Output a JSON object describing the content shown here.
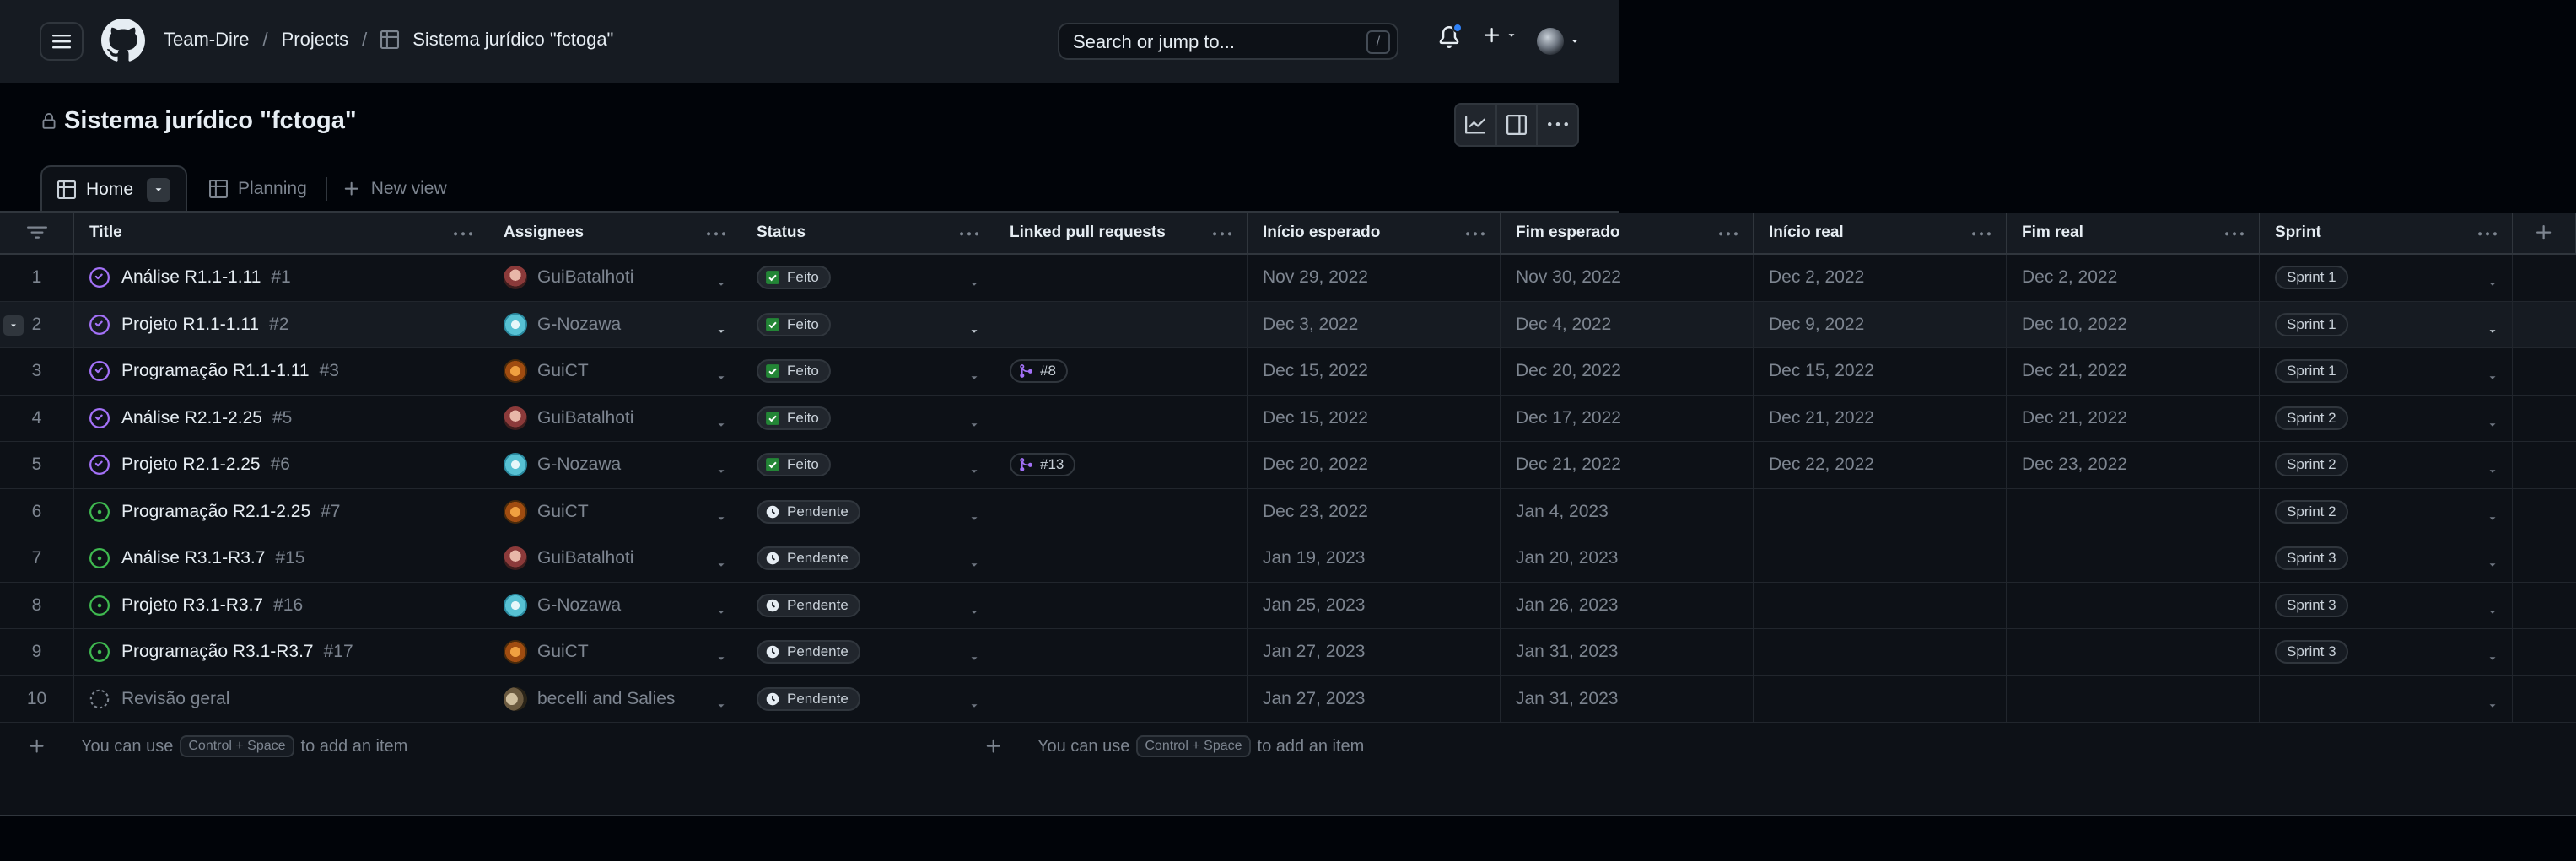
{
  "header": {
    "org": "Team-Dire",
    "projects": "Projects",
    "project": "Sistema jurídico \"fctoga\"",
    "search_placeholder": "Search or jump to...",
    "search_shortcut": "/"
  },
  "project_title": "Sistema jurídico \"fctoga\"",
  "views": {
    "home": "Home",
    "planning": "Planning",
    "new_view": "New view"
  },
  "columns": {
    "title": "Title",
    "assignees": "Assignees",
    "status": "Status",
    "linked_prs": "Linked pull requests",
    "inicio_esperado": "Início esperado",
    "fim_esperado": "Fim esperado",
    "inicio_real": "Início real",
    "fim_real": "Fim real",
    "sprint": "Sprint"
  },
  "rows": [
    {
      "n": "1",
      "title": "Análise R1.1-1.11",
      "num": "#1",
      "assignee": "GuiBatalhoti",
      "status": "Feito",
      "pr": "",
      "ie": "Nov 29, 2022",
      "fe": "Nov 30, 2022",
      "ir": "Dec 2, 2022",
      "fr": "Dec 2, 2022",
      "sprint": "Sprint 1"
    },
    {
      "n": "2",
      "title": "Projeto R1.1-1.11",
      "num": "#2",
      "assignee": "G-Nozawa",
      "status": "Feito",
      "pr": "",
      "ie": "Dec 3, 2022",
      "fe": "Dec 4, 2022",
      "ir": "Dec 9, 2022",
      "fr": "Dec 10, 2022",
      "sprint": "Sprint 1"
    },
    {
      "n": "3",
      "title": "Programação R1.1-1.11",
      "num": "#3",
      "assignee": "GuiCT",
      "status": "Feito",
      "pr": "#8",
      "ie": "Dec 15, 2022",
      "fe": "Dec 20, 2022",
      "ir": "Dec 15, 2022",
      "fr": "Dec 21, 2022",
      "sprint": "Sprint 1"
    },
    {
      "n": "4",
      "title": "Análise R2.1-2.25",
      "num": "#5",
      "assignee": "GuiBatalhoti",
      "status": "Feito",
      "pr": "",
      "ie": "Dec 15, 2022",
      "fe": "Dec 17, 2022",
      "ir": "Dec 21, 2022",
      "fr": "Dec 21, 2022",
      "sprint": "Sprint 2"
    },
    {
      "n": "5",
      "title": "Projeto R2.1-2.25",
      "num": "#6",
      "assignee": "G-Nozawa",
      "status": "Feito",
      "pr": "#13",
      "ie": "Dec 20, 2022",
      "fe": "Dec 21, 2022",
      "ir": "Dec 22, 2022",
      "fr": "Dec 23, 2022",
      "sprint": "Sprint 2"
    },
    {
      "n": "6",
      "title": "Programação R2.1-2.25",
      "num": "#7",
      "assignee": "GuiCT",
      "status": "Pendente",
      "pr": "",
      "ie": "Dec 23, 2022",
      "fe": "Jan 4, 2023",
      "ir": "",
      "fr": "",
      "sprint": "Sprint 2"
    },
    {
      "n": "7",
      "title": "Análise R3.1-R3.7",
      "num": "#15",
      "assignee": "GuiBatalhoti",
      "status": "Pendente",
      "pr": "",
      "ie": "Jan 19, 2023",
      "fe": "Jan 20, 2023",
      "ir": "",
      "fr": "",
      "sprint": "Sprint 3"
    },
    {
      "n": "8",
      "title": "Projeto R3.1-R3.7",
      "num": "#16",
      "assignee": "G-Nozawa",
      "status": "Pendente",
      "pr": "",
      "ie": "Jan 25, 2023",
      "fe": "Jan 26, 2023",
      "ir": "",
      "fr": "",
      "sprint": "Sprint 3"
    },
    {
      "n": "9",
      "title": "Programação R3.1-R3.7",
      "num": "#17",
      "assignee": "GuiCT",
      "status": "Pendente",
      "pr": "",
      "ie": "Jan 27, 2023",
      "fe": "Jan 31, 2023",
      "ir": "",
      "fr": "",
      "sprint": "Sprint 3"
    },
    {
      "n": "10",
      "title": "Revisão geral",
      "num": "",
      "assignee": "becelli and Salies",
      "status": "Pendente",
      "pr": "",
      "ie": "Jan 27, 2023",
      "fe": "Jan 31, 2023",
      "ir": "",
      "fr": "",
      "sprint": ""
    }
  ],
  "add_item": {
    "prefix": "You can use",
    "shortcut": "Control + Space",
    "suffix": "to add an item"
  },
  "colors": {
    "done_purple": "#a371f7",
    "open_green": "#3fb950",
    "done_box": "#238636",
    "accent_blue": "#2f81f7"
  }
}
